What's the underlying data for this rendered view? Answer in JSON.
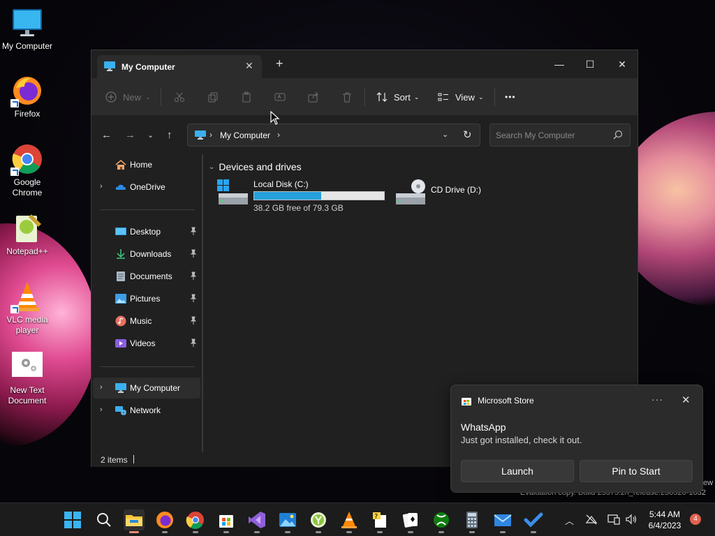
{
  "desktop": {
    "icons": [
      {
        "label": "My Computer"
      },
      {
        "label": "Firefox"
      },
      {
        "label": "Google Chrome"
      },
      {
        "label": "Notepad++"
      },
      {
        "label": "VLC media player"
      },
      {
        "label": "New Text Document"
      }
    ]
  },
  "explorer": {
    "tab_title": "My Computer",
    "tab_close": "✕",
    "tab_add": "+",
    "window_buttons": {
      "minimize": "—",
      "maximize": "☐",
      "close": "✕"
    },
    "commands": {
      "new": "New",
      "sort": "Sort",
      "view": "View",
      "more": "•••"
    },
    "address": {
      "location": "My Computer"
    },
    "search": {
      "placeholder": "Search My Computer"
    },
    "sidebar": {
      "items": [
        {
          "label": "Home"
        },
        {
          "label": "OneDrive"
        },
        {
          "label": "Desktop"
        },
        {
          "label": "Downloads"
        },
        {
          "label": "Documents"
        },
        {
          "label": "Pictures"
        },
        {
          "label": "Music"
        },
        {
          "label": "Videos"
        },
        {
          "label": "My Computer"
        },
        {
          "label": "Network"
        }
      ]
    },
    "content": {
      "group_header": "Devices and drives",
      "drives": [
        {
          "name": "Local Disk (C:)",
          "free_text": "38.2 GB free of 79.3 GB",
          "used_fraction": 0.518
        },
        {
          "name": "CD Drive (D:)"
        }
      ]
    },
    "status": {
      "items": "2 items"
    }
  },
  "toast": {
    "app": "Microsoft Store",
    "more": "···",
    "close": "✕",
    "title": "WhatsApp",
    "body": "Just got installed, check it out.",
    "launch": "Launch",
    "pin": "Pin to Start"
  },
  "watermark": {
    "line1": "Evaluation copy. Build 25375.zn_release.230520-1632",
    "line0_fragment": "ew"
  },
  "taskbar": {
    "clock_time": "5:44 AM",
    "clock_date": "6/4/2023",
    "notification_count": "4"
  },
  "colors": {
    "accent": "#26a0da",
    "window_bg": "#202020",
    "commandbar_bg": "#2c2c2c",
    "badge": "#e0624f"
  }
}
